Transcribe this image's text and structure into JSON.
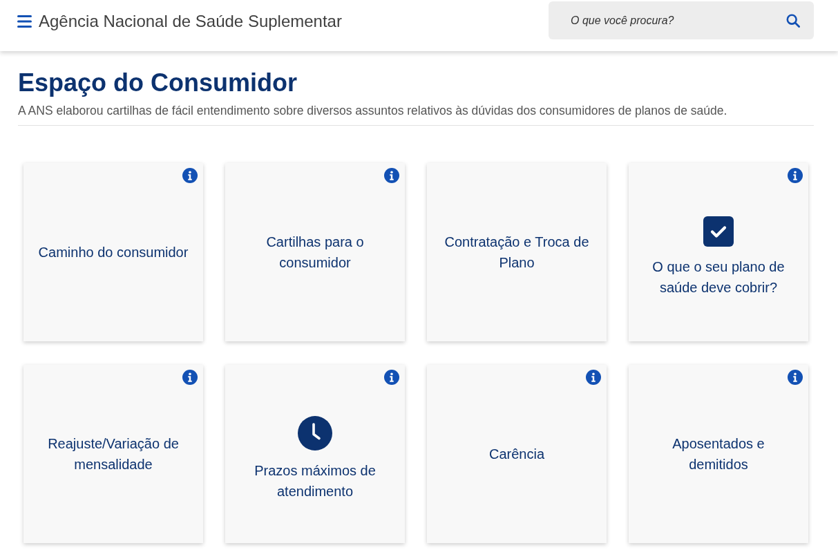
{
  "header": {
    "title": "Agência Nacional de Saúde Suplementar",
    "search": {
      "placeholder": "O que você procura?"
    }
  },
  "page": {
    "title": "Espaço do Consumidor",
    "description": "A ANS elaborou cartilhas de fácil entendimento sobre diversos assuntos relativos às dúvidas dos consumidores de planos de saúde."
  },
  "cards": [
    {
      "label": "Caminho do consumidor",
      "kind": "plain",
      "info": true
    },
    {
      "label": "Cartilhas para o consumidor",
      "kind": "plain",
      "info": true
    },
    {
      "label": "Contratação e Troca de Plano",
      "kind": "plain",
      "info": false
    },
    {
      "label": "O que o seu plano de saúde deve cobrir?",
      "kind": "check",
      "info": true
    },
    {
      "label": "Reajuste/Variação de mensalidade",
      "kind": "plain",
      "info": true
    },
    {
      "label": "Prazos máximos de atendimento",
      "kind": "clock",
      "info": true
    },
    {
      "label": "Carência",
      "kind": "plain",
      "info": true
    },
    {
      "label": "Aposentados e demitidos",
      "kind": "plain",
      "info": true
    }
  ]
}
